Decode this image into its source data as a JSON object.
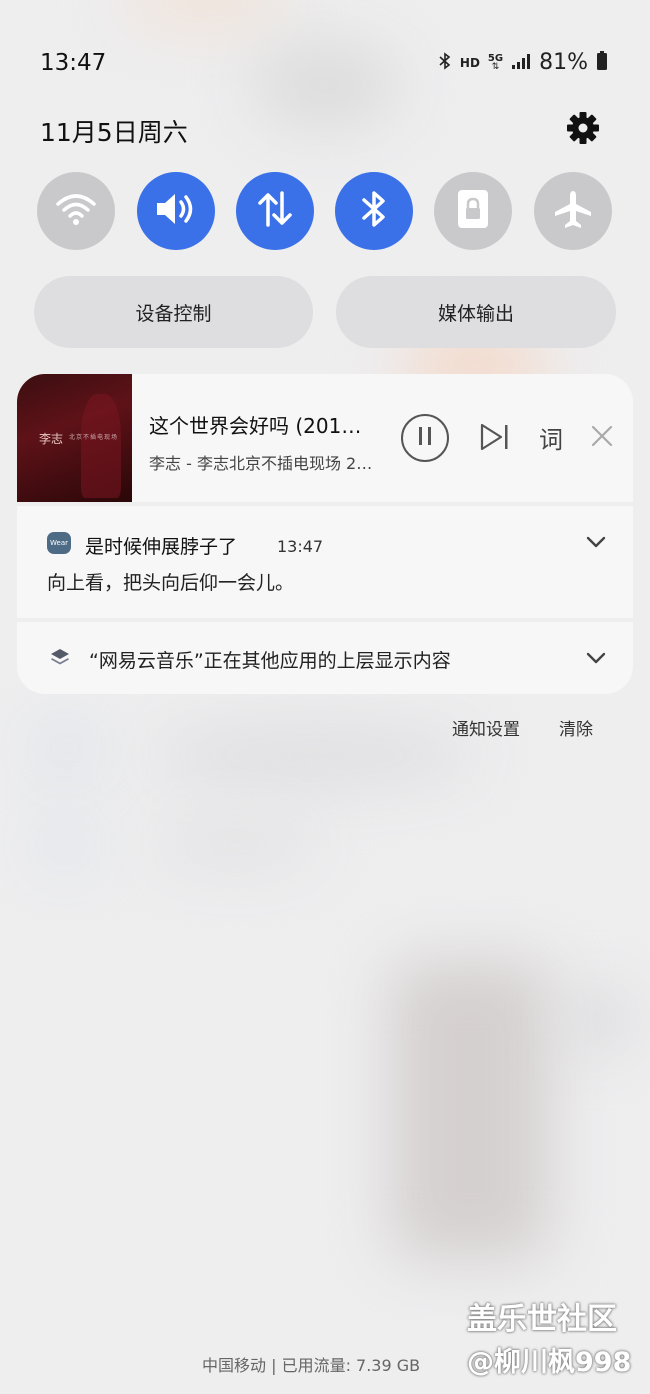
{
  "status_bar": {
    "time": "13:47",
    "hd_label": "HD",
    "network_label": "5G",
    "battery_percent": "81%",
    "icons": [
      "bluetooth-icon",
      "hd-icon",
      "5g-icon",
      "signal-icon",
      "battery-icon"
    ]
  },
  "header": {
    "date": "11月5日周六",
    "settings_icon": "gear-icon"
  },
  "quick_toggles": [
    {
      "name": "wifi",
      "icon": "wifi-icon",
      "state": "off"
    },
    {
      "name": "sound",
      "icon": "speaker-icon",
      "state": "on"
    },
    {
      "name": "mobile-data",
      "icon": "data-arrows-icon",
      "state": "on"
    },
    {
      "name": "bluetooth",
      "icon": "bluetooth-icon",
      "state": "on"
    },
    {
      "name": "rotation-lock",
      "icon": "lock-icon",
      "state": "off"
    },
    {
      "name": "airplane-mode",
      "icon": "airplane-icon",
      "state": "off"
    }
  ],
  "pills": {
    "device_control": "设备控制",
    "media_output": "媒体输出"
  },
  "media": {
    "title": "这个世界会好吗 (201…",
    "artist": "李志 - 李志北京不插电现场 2…",
    "album_art_text": "李志",
    "album_art_subtext": "北京不插电现场",
    "lyrics_label": "词",
    "controls": [
      "pause-icon",
      "next-icon",
      "close-icon"
    ]
  },
  "notification": {
    "app_icon_label": "Wear",
    "title": "是时候伸展脖子了",
    "time": "13:47",
    "body": "向上看，把头向后仰一会儿。"
  },
  "overlay_notice": {
    "text": "“网易云音乐”正在其他应用的上层显示内容"
  },
  "actions": {
    "notification_settings": "通知设置",
    "clear": "清除"
  },
  "footer": {
    "carrier_info": "中国移动 | 已用流量: 7.39 GB"
  },
  "watermark": {
    "line1": "盖乐世社区",
    "line2": "@柳川枫998"
  },
  "colors": {
    "accent_on": "#3a70e8",
    "toggle_off": "#c9c9cb",
    "background": "#eeeeef"
  }
}
